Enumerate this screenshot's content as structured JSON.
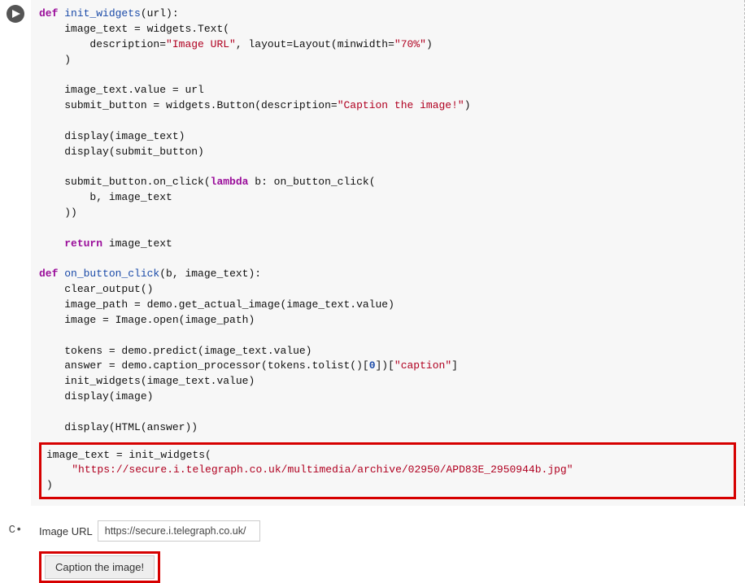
{
  "code": {
    "l1": {
      "def": "def ",
      "fn": "init_widgets",
      "rest": "(url):"
    },
    "l2": {
      "a": "image_text = widgets.Text(",
      "b": ""
    },
    "l3": {
      "a": "description=",
      "s1": "\"Image URL\"",
      "b": ", layout=Layout(minwidth=",
      "s2": "\"70%\"",
      "c": ")"
    },
    "l4": ")",
    "l5": "image_text.value = url",
    "l6": {
      "a": "submit_button = widgets.Button(description=",
      "s": "\"Caption the image!\"",
      "b": ")"
    },
    "l7": "display(image_text)",
    "l8": "display(submit_button)",
    "l9": {
      "a": "submit_button.on_click(",
      "kw": "lambda",
      "b": " b: on_button_click("
    },
    "l10": "b, image_text",
    "l11": "))",
    "l12": {
      "kw": "return",
      "rest": " image_text"
    },
    "l13": {
      "def": "def ",
      "fn": "on_button_click",
      "rest": "(b, image_text):"
    },
    "l14": "clear_output()",
    "l15": "image_path = demo.get_actual_image(image_text.value)",
    "l16": "image = Image.open(image_path)",
    "l17": "tokens = demo.predict(image_text.value)",
    "l18": {
      "a": "answer = demo.caption_processor(tokens.tolist()[",
      "n": "0",
      "b": "])[",
      "s": "\"caption\"",
      "c": "]"
    },
    "l19": "init_widgets(image_text.value)",
    "l20": "display(image)",
    "l21": "display(HTML(answer))",
    "hl1": "image_text = init_widgets(",
    "hl2": "\"https://secure.i.telegraph.co.uk/multimedia/archive/02950/APD83E_2950944b.jpg\"",
    "hl3": ")"
  },
  "output": {
    "label": "Image URL",
    "input_value": "https://secure.i.telegraph.co.uk/",
    "button": "Caption the image!",
    "out_marker": "C•"
  }
}
